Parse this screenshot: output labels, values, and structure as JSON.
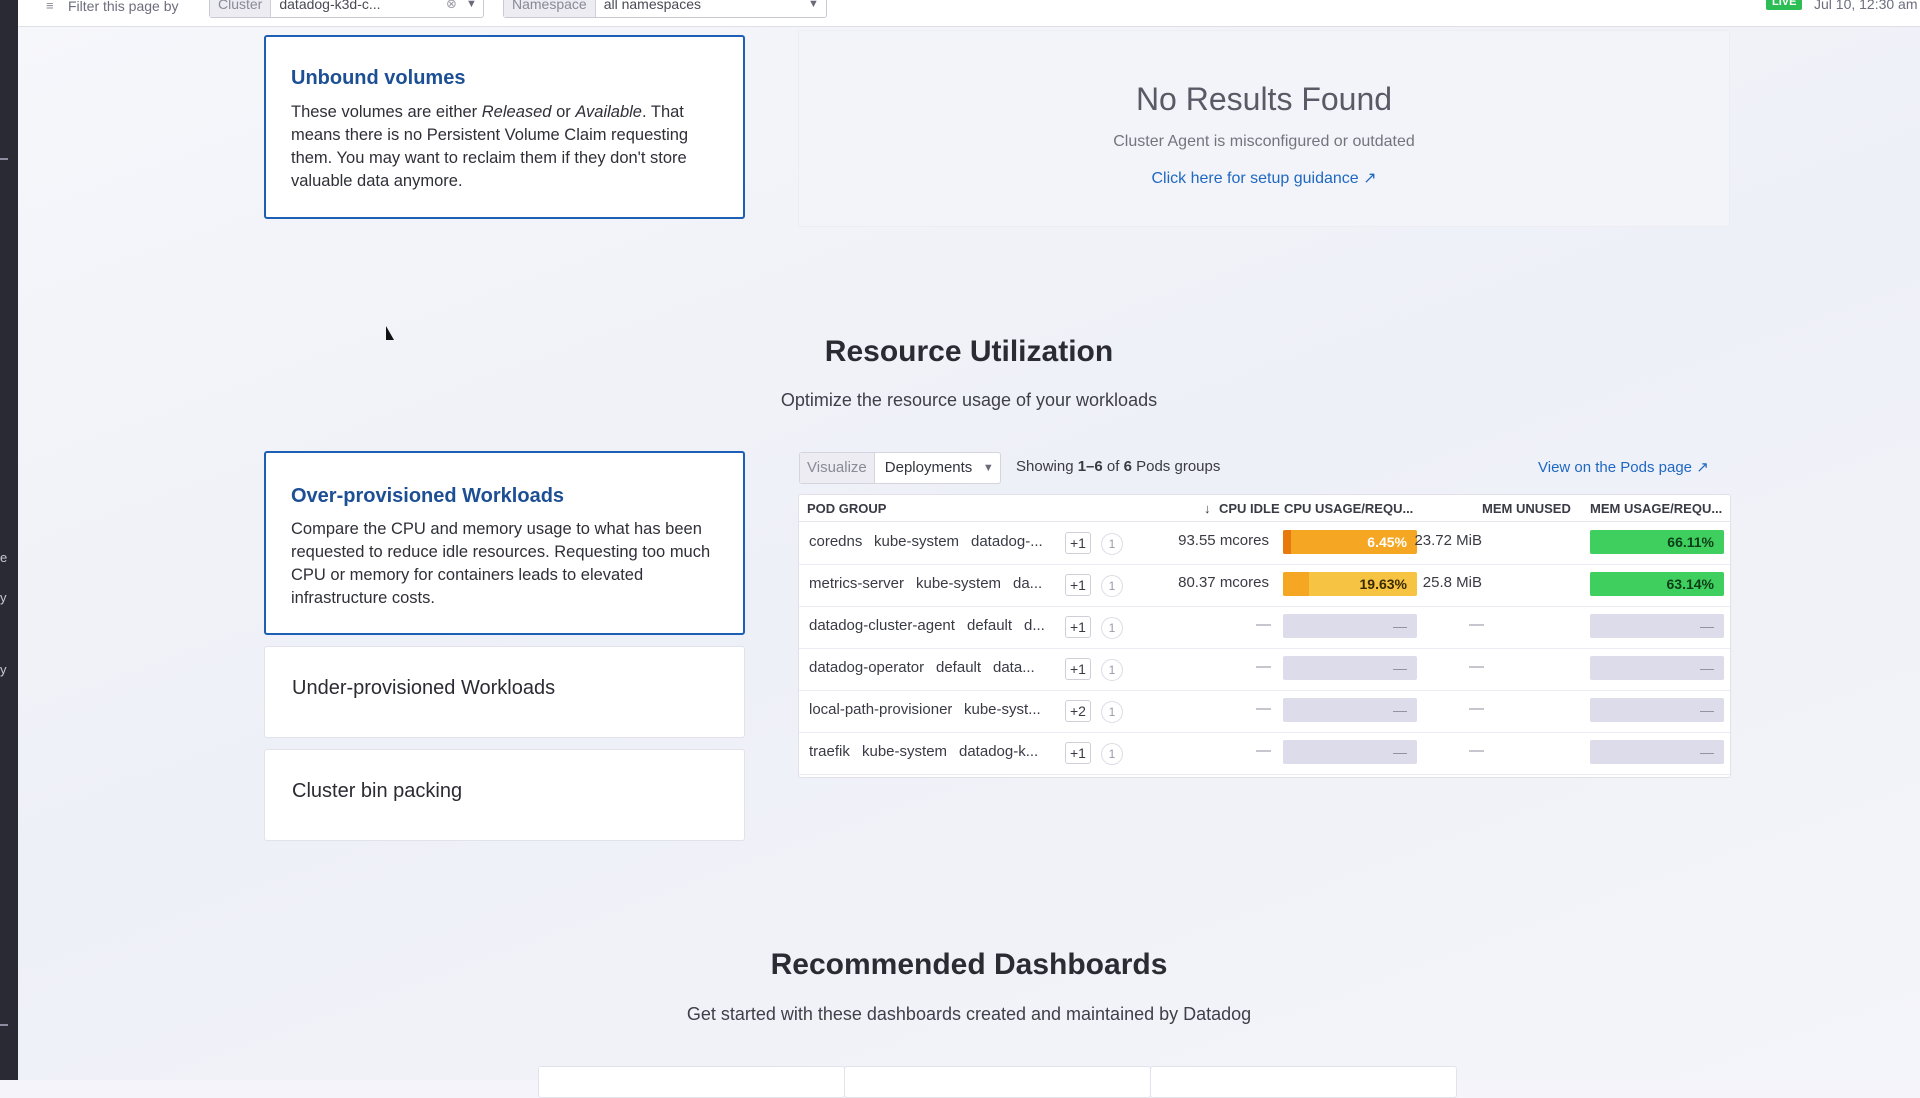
{
  "filters": {
    "label": "Filter this page by",
    "cluster_key": "Cluster",
    "cluster_value": "datadog-k3d-c...",
    "namespace_key": "Namespace",
    "namespace_value": "all namespaces",
    "live": "LIVE",
    "time": "Jul 10, 12:30 am"
  },
  "unbound": {
    "title": "Unbound volumes",
    "text_1": "These volumes are either ",
    "released": "Released",
    "or": " or ",
    "available": "Available",
    "text_2": ". That means there is no Persistent Volume Claim requesting them. You may want to reclaim them if they don't store valuable data anymore."
  },
  "no_results": {
    "title": "No Results Found",
    "subtitle": "Cluster Agent is misconfigured or outdated",
    "link": "Click here for setup guidance"
  },
  "resource": {
    "title": "Resource Utilization",
    "subtitle": "Optimize the resource usage of your workloads"
  },
  "cards": {
    "over_title": "Over-provisioned Workloads",
    "over_text": "Compare the CPU and memory usage to what has been requested to reduce idle resources. Requesting too much CPU or memory for containers leads to elevated infrastructure costs.",
    "under_title": "Under-provisioned Workloads",
    "bin_title": "Cluster bin packing"
  },
  "controls": {
    "visualize_key": "Visualize",
    "visualize_value": "Deployments",
    "showing_prefix": "Showing ",
    "showing_range": "1–6",
    "showing_of": " of ",
    "showing_total": "6",
    "showing_suffix": " Pods groups",
    "view_pods": "View on the Pods page"
  },
  "table": {
    "headers": {
      "pod_group": "POD GROUP",
      "cpu_idle": "CPU IDLE",
      "cpu_usage": "CPU USAGE/REQU...",
      "mem_unused": "MEM UNUSED",
      "mem_usage": "MEM USAGE/REQU..."
    },
    "rows": [
      {
        "name": "coredns",
        "ns": "kube-system",
        "extra": "datadog-...",
        "plus": "+1",
        "count": "1",
        "cpu_idle": "93.55 mcores",
        "cpu_pct": "6.45%",
        "cpu_val": 6.45,
        "mem_unused": "23.72 MiB",
        "mem_pct": "66.11%",
        "mem_val": 66.11
      },
      {
        "name": "metrics-server",
        "ns": "kube-system",
        "extra": "da...",
        "plus": "+1",
        "count": "1",
        "cpu_idle": "80.37 mcores",
        "cpu_pct": "19.63%",
        "cpu_val": 19.63,
        "mem_unused": "25.8 MiB",
        "mem_pct": "63.14%",
        "mem_val": 63.14
      },
      {
        "name": "datadog-cluster-agent",
        "ns": "default",
        "extra": "d...",
        "plus": "+1",
        "count": "1",
        "cpu_idle": "—",
        "cpu_pct": "—",
        "cpu_val": 0,
        "mem_unused": "—",
        "mem_pct": "—",
        "mem_val": 0
      },
      {
        "name": "datadog-operator",
        "ns": "default",
        "extra": "data...",
        "plus": "+1",
        "count": "1",
        "cpu_idle": "—",
        "cpu_pct": "—",
        "cpu_val": 0,
        "mem_unused": "—",
        "mem_pct": "—",
        "mem_val": 0
      },
      {
        "name": "local-path-provisioner",
        "ns": "kube-syst...",
        "extra": "",
        "plus": "+2",
        "count": "1",
        "cpu_idle": "—",
        "cpu_pct": "—",
        "cpu_val": 0,
        "mem_unused": "—",
        "mem_pct": "—",
        "mem_val": 0
      },
      {
        "name": "traefik",
        "ns": "kube-system",
        "extra": "datadog-k...",
        "plus": "+1",
        "count": "1",
        "cpu_idle": "—",
        "cpu_pct": "—",
        "cpu_val": 0,
        "mem_unused": "—",
        "mem_pct": "—",
        "mem_val": 0
      }
    ]
  },
  "dashboards": {
    "title": "Recommended Dashboards",
    "subtitle": "Get started with these dashboards created and maintained by Datadog"
  },
  "colors": {
    "accent": "#1d5fb5",
    "link": "#1f68c1",
    "cpu_bar": "#f5a623",
    "cpu_bar_dark": "#e8790d",
    "mem_bar": "#3fcf5e"
  }
}
